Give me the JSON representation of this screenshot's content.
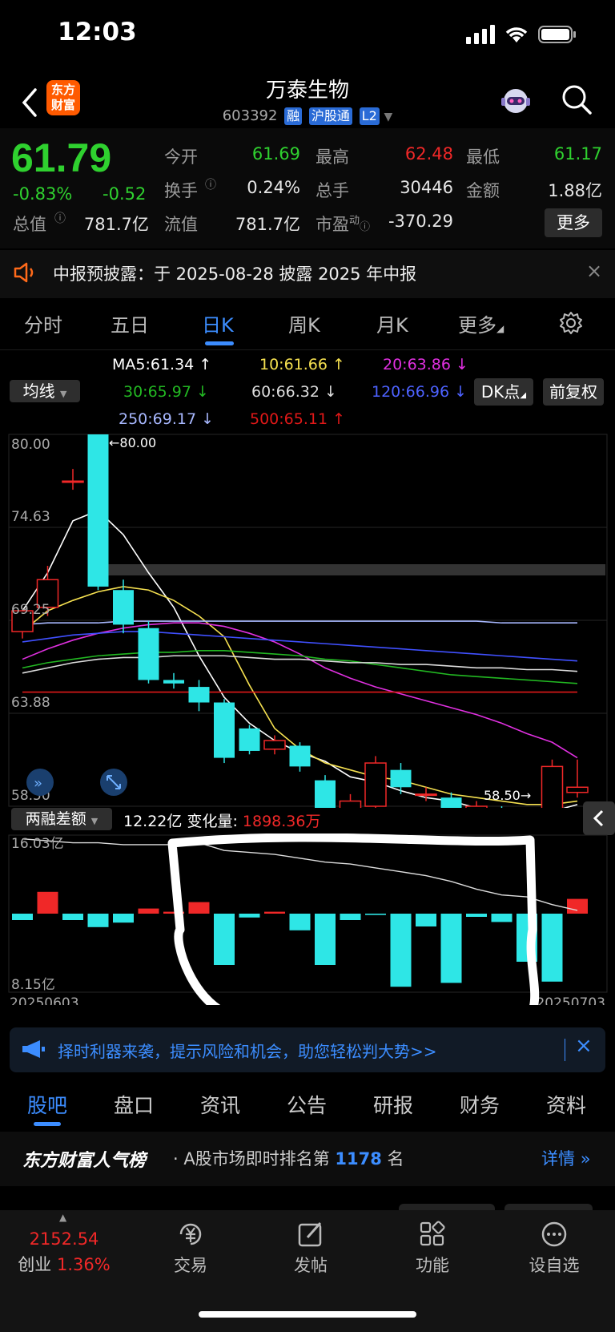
{
  "status": {
    "time": "12:03"
  },
  "header": {
    "logo_text_1": "东方",
    "logo_text_2": "财富",
    "stock_name": "万泰生物",
    "stock_code": "603392",
    "tag_margin": "融",
    "tag_connect": "沪股通",
    "tag_level": "L2"
  },
  "quote": {
    "price": "61.79",
    "change_pct": "-0.83%",
    "change": "-0.52",
    "open_label": "今开",
    "open": "61.69",
    "high_label": "最高",
    "high": "62.48",
    "low_label": "最低",
    "low": "61.17",
    "turnover_label": "换手",
    "turnover": "0.24%",
    "volume_label": "总手",
    "volume": "30446",
    "amount_label": "金额",
    "amount": "1.88亿",
    "mktcap_label": "总值",
    "mktcap": "781.7亿",
    "float_label": "流值",
    "float": "781.7亿",
    "pe_label": "市盈",
    "pe_sup": "动",
    "pe": "-370.29",
    "more": "更多"
  },
  "notice": {
    "text": "中报预披露：于 2025-08-28 披露 2025 年中报"
  },
  "tabs": [
    "分时",
    "五日",
    "日K",
    "周K",
    "月K",
    "更多"
  ],
  "active_tab": "日K",
  "ma": {
    "selector": "均线",
    "ma5": "MA5:61.34",
    "ma10": "10:61.66",
    "ma20": "20:63.86",
    "ma30": "30:65.97",
    "ma60": "60:66.32",
    "ma120": "120:66.96",
    "ma250": "250:69.17",
    "ma500": "500:65.11",
    "dk_button": "DK点",
    "adjust_button": "前复权"
  },
  "colors": {
    "up": "#f02828",
    "down": "#2ee6e6",
    "ma5": "#ffffff",
    "ma10": "#f5e050",
    "ma20": "#e030e0",
    "ma30": "#22b822",
    "ma60": "#dddddd",
    "ma120": "#4050ff",
    "ma250": "#a8b8ff",
    "ma500": "#e01818",
    "accent": "#3c8dff"
  },
  "kchart": {
    "y_labels": [
      "80.00",
      "74.63",
      "69.25",
      "63.88",
      "58.50"
    ],
    "high_marker": "80.00",
    "low_marker": "58.50"
  },
  "chart_data": {
    "type": "candlestick",
    "ylim": [
      58.5,
      80.0
    ],
    "candles": [
      {
        "o": 68.6,
        "c": 69.8,
        "h": 69.8,
        "l": 68.2
      },
      {
        "o": 70.0,
        "c": 71.6,
        "h": 72.4,
        "l": 69.5
      },
      {
        "o": 77.3,
        "c": 77.3,
        "h": 78.0,
        "l": 76.8
      },
      {
        "o": 80.0,
        "c": 71.2,
        "h": 80.0,
        "l": 71.0
      },
      {
        "o": 71.0,
        "c": 69.0,
        "h": 71.6,
        "l": 68.5
      },
      {
        "o": 68.8,
        "c": 65.8,
        "h": 69.2,
        "l": 65.6
      },
      {
        "o": 65.8,
        "c": 65.6,
        "h": 66.2,
        "l": 65.3
      },
      {
        "o": 65.4,
        "c": 64.5,
        "h": 65.8,
        "l": 64.0
      },
      {
        "o": 64.5,
        "c": 61.3,
        "h": 64.7,
        "l": 61.0
      },
      {
        "o": 63.0,
        "c": 61.7,
        "h": 63.2,
        "l": 61.5
      },
      {
        "o": 61.8,
        "c": 62.3,
        "h": 62.6,
        "l": 61.5
      },
      {
        "o": 62.0,
        "c": 60.8,
        "h": 62.2,
        "l": 60.5
      },
      {
        "o": 60.0,
        "c": 57.6,
        "h": 60.3,
        "l": 57.4
      },
      {
        "o": 57.4,
        "c": 58.8,
        "h": 59.2,
        "l": 57.3
      },
      {
        "o": 58.5,
        "c": 61.0,
        "h": 61.4,
        "l": 58.2
      },
      {
        "o": 60.6,
        "c": 59.6,
        "h": 61.0,
        "l": 59.2
      },
      {
        "o": 59.2,
        "c": 59.2,
        "h": 59.6,
        "l": 58.8
      },
      {
        "o": 59.0,
        "c": 57.6,
        "h": 59.3,
        "l": 57.3
      },
      {
        "o": 57.8,
        "c": 58.5,
        "h": 58.8,
        "l": 57.6
      },
      {
        "o": 58.2,
        "c": 57.7,
        "h": 58.5,
        "l": 57.5
      },
      {
        "o": 57.4,
        "c": 56.6,
        "h": 57.8,
        "l": 55.8
      },
      {
        "o": 56.3,
        "c": 60.8,
        "h": 61.2,
        "l": 54.6
      },
      {
        "o": 59.3,
        "c": 59.6,
        "h": 61.2,
        "l": 59.0
      }
    ],
    "ma_lines": {
      "ma5": [
        69.8,
        72.0,
        75.0,
        75.6,
        74.2,
        72.0,
        70.0,
        67.2,
        64.8,
        63.3,
        62.3,
        61.6,
        61.1,
        60.2,
        59.9,
        59.4,
        59.0,
        58.8,
        58.4,
        58.2,
        58.0,
        58.2,
        58.6
      ],
      "ma10": [
        68.6,
        69.8,
        70.4,
        70.9,
        71.2,
        71.0,
        70.4,
        69.5,
        68.3,
        65.5,
        63.0,
        61.8,
        61.0,
        60.6,
        60.2,
        60.0,
        59.6,
        59.2,
        59.0,
        58.8,
        58.6,
        58.6,
        58.8
      ],
      "ma20": [
        67.0,
        67.6,
        68.1,
        68.5,
        68.8,
        69.0,
        69.1,
        69.1,
        68.9,
        68.5,
        68.0,
        67.3,
        66.5,
        65.9,
        65.4,
        65.0,
        64.6,
        64.2,
        63.8,
        63.3,
        62.7,
        62.2,
        61.3
      ],
      "ma30": [
        66.5,
        66.8,
        67.0,
        67.2,
        67.3,
        67.4,
        67.4,
        67.5,
        67.5,
        67.4,
        67.3,
        67.2,
        67.0,
        66.9,
        66.7,
        66.5,
        66.3,
        66.1,
        66.0,
        65.9,
        65.8,
        65.7,
        65.6
      ],
      "ma60": [
        66.2,
        66.5,
        66.8,
        67.0,
        67.1,
        67.1,
        67.2,
        67.2,
        67.2,
        67.1,
        67.0,
        67.0,
        66.9,
        66.8,
        66.8,
        66.7,
        66.7,
        66.6,
        66.5,
        66.5,
        66.4,
        66.4,
        66.3
      ],
      "ma120": [
        68.0,
        68.2,
        68.4,
        68.5,
        68.6,
        68.6,
        68.5,
        68.4,
        68.3,
        68.2,
        68.1,
        68.0,
        67.9,
        67.8,
        67.7,
        67.6,
        67.5,
        67.4,
        67.3,
        67.2,
        67.1,
        67.0,
        66.9
      ],
      "ma250": [
        69.0,
        69.1,
        69.1,
        69.1,
        69.2,
        69.2,
        69.2,
        69.2,
        69.2,
        69.2,
        69.2,
        69.2,
        69.2,
        69.2,
        69.2,
        69.2,
        69.2,
        69.2,
        69.2,
        69.1,
        69.1,
        69.1,
        69.1
      ],
      "ma500": [
        65.1,
        65.1,
        65.1,
        65.1,
        65.1,
        65.1,
        65.1,
        65.1,
        65.1,
        65.1,
        65.1,
        65.1,
        65.1,
        65.1,
        65.1,
        65.1,
        65.1,
        65.1,
        65.1,
        65.1,
        65.1,
        65.1,
        65.1
      ]
    },
    "margin_balance_line": [
      16.0,
      15.9,
      15.8,
      15.8,
      15.7,
      15.7,
      15.7,
      15.8,
      15.4,
      15.3,
      15.2,
      15.0,
      14.8,
      14.7,
      14.5,
      14.3,
      14.1,
      13.8,
      13.4,
      13.1,
      13.0,
      12.6,
      12.3
    ],
    "margin_change_bars": [
      -1.0,
      3.4,
      -1.0,
      -2.1,
      -1.4,
      0.8,
      0.3,
      1.8,
      -8.0,
      -0.6,
      0.3,
      -2.6,
      -8.0,
      -1.0,
      -0.2,
      -11.4,
      -2.0,
      -10.8,
      -0.5,
      -1.3,
      -7.5,
      -10.6,
      2.3
    ]
  },
  "margin": {
    "selector": "两融差额",
    "value": "12.22亿",
    "change_label": "变化量:",
    "change_value": "1898.36万",
    "top_label": "16.03亿",
    "bottom_label": "8.15亿",
    "start_date": "20250603",
    "end_date": "20250703"
  },
  "banner": {
    "text": "择时利器来袭，提示风险和机会，助您轻松判大势>>"
  },
  "bottom_tabs": [
    "股吧",
    "盘口",
    "资讯",
    "公告",
    "研报",
    "财务",
    "资料"
  ],
  "popular": {
    "title": "东方财富人气榜",
    "text_prefix": "· A股市场即时排名第",
    "rank": "1178",
    "text_suffix": "名",
    "detail": "详情"
  },
  "toolbar": {
    "index_value": "2152.54",
    "index_name": "创业",
    "index_change": "1.36%",
    "trade": "交易",
    "post": "发帖",
    "function": "功能",
    "watchlist": "设自选"
  }
}
